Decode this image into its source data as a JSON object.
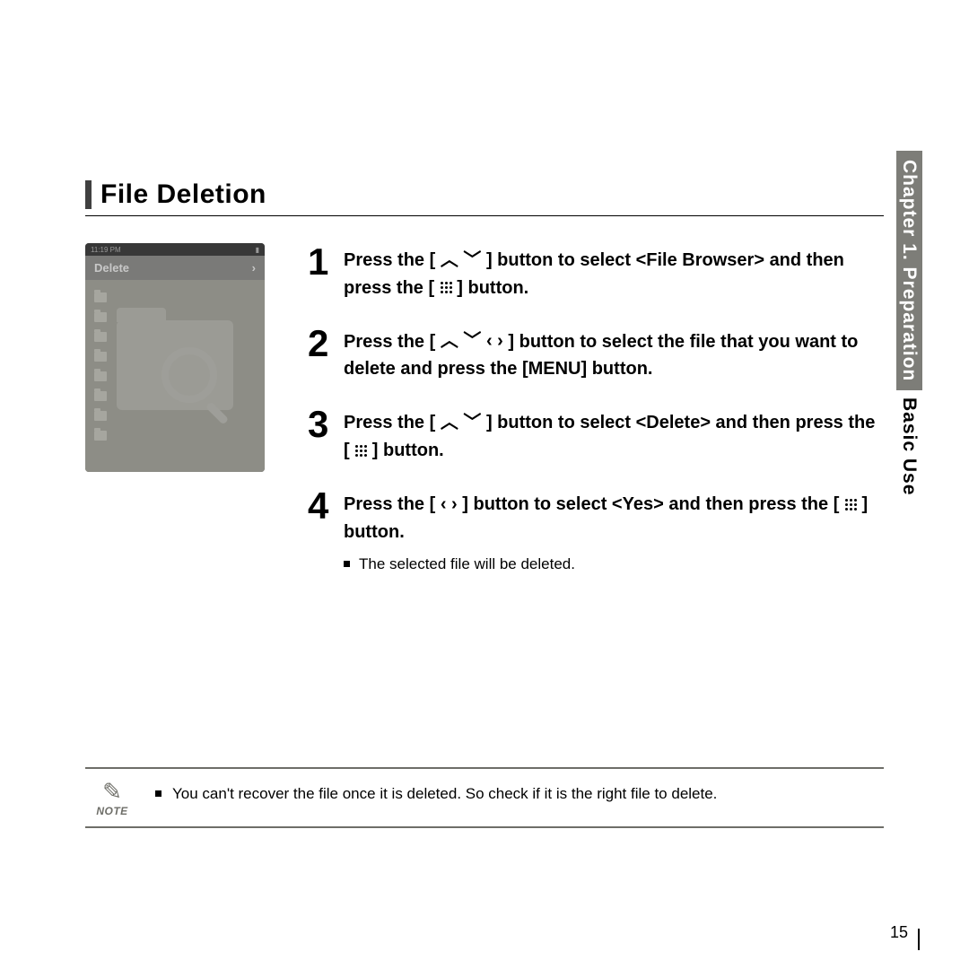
{
  "title": "File Deletion",
  "device": {
    "status_time": "11:19 PM",
    "header_label": "Delete",
    "header_arrow": "›"
  },
  "steps": [
    {
      "num": "1",
      "parts": [
        "Press the [ ",
        "UPDOWN",
        " ] button to select <File Browser> and then press the [ ",
        "DOTS",
        " ] button."
      ]
    },
    {
      "num": "2",
      "parts": [
        "Press the [ ",
        "UPDOWNLR",
        " ] button to select the file that you want to delete and press the [MENU] button."
      ]
    },
    {
      "num": "3",
      "parts": [
        "Press the [ ",
        "UPDOWN",
        " ] button to select <Delete> and then press the [ ",
        "DOTS",
        " ] button."
      ]
    },
    {
      "num": "4",
      "parts": [
        "Press the [ ",
        "LR",
        " ] button to select <Yes> and then press the [ ",
        "DOTS",
        " ] button."
      ],
      "bullet": "The selected file will be deleted."
    }
  ],
  "side": {
    "chapter": "Chapter 1. Preparation",
    "section": "Basic Use"
  },
  "note": {
    "label": "NOTE",
    "text": "You can't recover the file once it is deleted. So check if it is the right file to delete."
  },
  "page_number": "15",
  "glyphs": {
    "up": "︿",
    "down": "﹀",
    "left": "‹",
    "right": "›"
  }
}
